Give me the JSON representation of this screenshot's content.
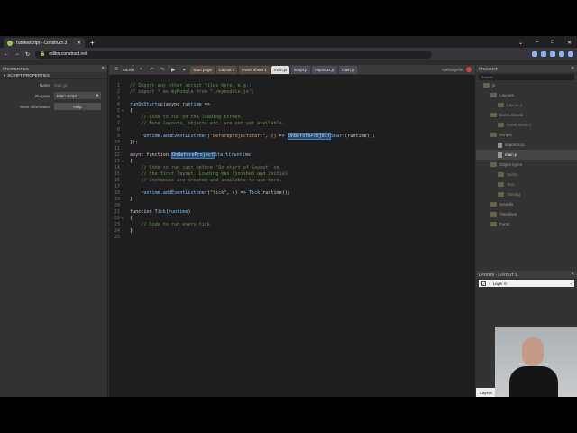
{
  "browser": {
    "tab_title": "Tutokescript - Construct 3",
    "url": "editor.construct.net",
    "new_tab": "+",
    "controls": [
      "⌄",
      "–",
      "□",
      "✕"
    ]
  },
  "left_panel": {
    "header": "PROPERTIES",
    "section": "SCRIPT PROPERTIES",
    "rows": [
      {
        "key": "Name",
        "value": "main.js"
      },
      {
        "key": "Purpose",
        "value": "Main script"
      },
      {
        "key": "More information",
        "value": "Help"
      }
    ]
  },
  "toolbar": {
    "menu": "MENU",
    "tabs": [
      "Start page",
      "Layout 1",
      "Event sheet 1",
      "main.js",
      "script.js",
      "importJs.js",
      "main.js"
    ],
    "user": "Anthony/OK"
  },
  "code": [
    {
      "n": "1",
      "f": "",
      "t": [
        [
          "cm",
          "// Import any other script files here, e.g.:"
        ]
      ]
    },
    {
      "n": "2",
      "f": "",
      "t": [
        [
          "cm",
          "// import * as myModule from \"./mymodule.js\";"
        ]
      ]
    },
    {
      "n": "3",
      "f": "",
      "t": []
    },
    {
      "n": "4",
      "f": "",
      "t": [
        [
          "fn",
          "runOnStartup"
        ],
        [
          "id",
          "(async "
        ],
        [
          "fn",
          "runtime"
        ],
        [
          "id",
          " =>"
        ]
      ]
    },
    {
      "n": "5",
      "f": "▾",
      "t": [
        [
          "id",
          "{"
        ]
      ]
    },
    {
      "n": "6",
      "f": "",
      "t": [
        [
          "cm",
          "    // Code to run on the loading screen."
        ]
      ]
    },
    {
      "n": "7",
      "f": "",
      "t": [
        [
          "cm",
          "    // Note layouts, objects etc. are not yet available."
        ]
      ]
    },
    {
      "n": "8",
      "f": "",
      "t": []
    },
    {
      "n": "9",
      "f": "",
      "t": [
        [
          "fn",
          "    runtime"
        ],
        [
          "id",
          "."
        ],
        [
          "fn",
          "addEventListener"
        ],
        [
          "id",
          "("
        ],
        [
          "str",
          "\"beforeprojectstart\""
        ],
        [
          "id",
          ", () => "
        ],
        [
          "hl",
          "OnBeforeProject"
        ],
        [
          "fn",
          "Start"
        ],
        [
          "id",
          "(runtime));"
        ]
      ]
    },
    {
      "n": "10",
      "f": "",
      "t": [
        [
          "id",
          "});"
        ]
      ]
    },
    {
      "n": "11",
      "f": "",
      "t": []
    },
    {
      "n": "12",
      "f": "",
      "t": [
        [
          "kw",
          "async "
        ],
        [
          "id",
          "function "
        ],
        [
          "hl",
          "OnBeforeProject"
        ],
        [
          "fn",
          "Start"
        ],
        [
          "id",
          "("
        ],
        [
          "fn",
          "runtime"
        ],
        [
          "id",
          ")"
        ]
      ]
    },
    {
      "n": "13",
      "f": "▾",
      "t": [
        [
          "id",
          "{"
        ]
      ]
    },
    {
      "n": "14",
      "f": "",
      "t": [
        [
          "cm",
          "    // Code to run just before 'On start of layout' on"
        ]
      ]
    },
    {
      "n": "15",
      "f": "",
      "t": [
        [
          "cm",
          "    // the first layout. Loading has finished and initial"
        ]
      ]
    },
    {
      "n": "16",
      "f": "",
      "t": [
        [
          "cm",
          "    // instances are created and available to use here."
        ]
      ]
    },
    {
      "n": "17",
      "f": "",
      "t": []
    },
    {
      "n": "18",
      "f": "",
      "t": [
        [
          "fn",
          "    runtime"
        ],
        [
          "id",
          "."
        ],
        [
          "fn",
          "addEventListener"
        ],
        [
          "id",
          "("
        ],
        [
          "str",
          "\"tick\""
        ],
        [
          "id",
          ", () => "
        ],
        [
          "fn",
          "Tick"
        ],
        [
          "id",
          "(runtime));"
        ]
      ]
    },
    {
      "n": "19",
      "f": "",
      "t": [
        [
          "id",
          "}"
        ]
      ]
    },
    {
      "n": "20",
      "f": "",
      "t": []
    },
    {
      "n": "21",
      "f": "",
      "t": [
        [
          "id",
          "function "
        ],
        [
          "fn",
          "Tick"
        ],
        [
          "id",
          "("
        ],
        [
          "fn",
          "runtime"
        ],
        [
          "id",
          ")"
        ]
      ]
    },
    {
      "n": "22",
      "f": "▾",
      "t": [
        [
          "id",
          "{"
        ]
      ]
    },
    {
      "n": "23",
      "f": "",
      "t": [
        [
          "cm",
          "    // Code to run every tick"
        ]
      ]
    },
    {
      "n": "24",
      "f": "",
      "t": [
        [
          "id",
          "}"
        ]
      ]
    },
    {
      "n": "25",
      "f": "",
      "t": []
    }
  ],
  "project": {
    "header": "PROJECT",
    "search_placeholder": "Search",
    "tree": [
      {
        "label": "js",
        "type": "folder",
        "indent": 0
      },
      {
        "label": "Layouts",
        "type": "folder",
        "indent": 1
      },
      {
        "label": "Layout 1",
        "type": "dim",
        "indent": 2
      },
      {
        "label": "Event sheets",
        "type": "folder",
        "indent": 1
      },
      {
        "label": "Event sheet 1",
        "type": "dim",
        "indent": 2
      },
      {
        "label": "Scripts",
        "type": "folder",
        "indent": 1
      },
      {
        "label": "importJs.js",
        "type": "file",
        "indent": 2
      },
      {
        "label": "main.js",
        "type": "file",
        "indent": 2,
        "selected": true
      },
      {
        "label": "Object types",
        "type": "folder",
        "indent": 1
      },
      {
        "label": "Sprite",
        "type": "dim",
        "indent": 2
      },
      {
        "label": "Text",
        "type": "dim",
        "indent": 2
      },
      {
        "label": "TiledBg",
        "type": "dim",
        "indent": 2
      },
      {
        "label": "Sounds",
        "type": "folder",
        "indent": 1
      },
      {
        "label": "Timelines",
        "type": "folder",
        "indent": 1
      },
      {
        "label": "Fonts",
        "type": "folder",
        "indent": 1
      }
    ]
  },
  "layers": {
    "header": "LAYERS - LAYOUT 1",
    "row": "Layer 0",
    "tab": "Layers"
  }
}
